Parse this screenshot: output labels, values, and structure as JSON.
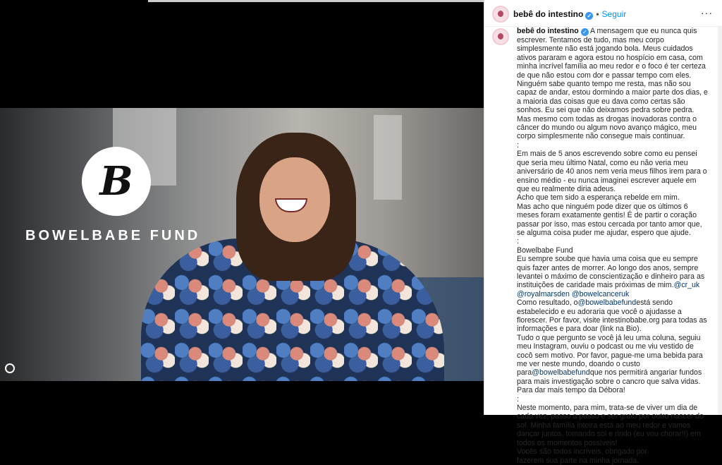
{
  "post": {
    "username": "bebê do intestino",
    "follow_label": "Seguir",
    "more_label": "···",
    "verified_mark": "✓"
  },
  "media": {
    "logo_letter": "B",
    "brand_text": "BOWELBABE FUND"
  },
  "caption": {
    "username": "bebê do intestino",
    "intro": " A mensagem que eu nunca quis escrever. Tentamos de tudo, mas meu corpo simplesmente não está jogando bola. Meus cuidados ativos pararam e agora estou no hospício em casa, com minha incrível família ao meu redor e o foco é ter certeza de que não estou com dor e passar tempo com eles. Ninguém sabe quanto tempo me resta, mas não sou capaz de andar, estou dormindo a maior parte dos dias, e a maioria das coisas que eu dava como certas são sonhos. Eu sei que não deixamos pedra sobre pedra. Mas mesmo com todas as drogas inovadoras contra o câncer do mundo ou algum novo avanço mágico, meu corpo simplesmente não consegue mais continuar.",
    "sep1": ":",
    "para2": "Em mais de 5 anos escrevendo sobre como eu pensei que seria meu último Natal, como eu não veria meu aniversário de 40 anos nem veria meus filhos irem para o ensino médio - eu nunca imaginei escrever aquele em que eu realmente diria adeus.",
    "para3": "Acho que tem sido a esperança rebelde em mim.",
    "para4": "Mas acho que ninguém pode dizer que os últimos 6 meses foram exatamente gentis! É de partir o coração passar por isso, mas estou cercada por tanto amor que, se alguma coisa puder me ajudar, espero que ajude.",
    "sep2": ":",
    "para5_title": "Bowelbabe Fund",
    "para5": "Eu sempre soube que havia uma coisa que eu sempre quis fazer antes de morrer. Ao longo dos anos, sempre levantei o máximo de conscientização e dinheiro para as instituições de caridade mais próximas de mim.",
    "mention1": "@cr_uk",
    "mention2": "@royalmarsden",
    "mention3": "@bowelcanceruk",
    "para6_a": "Como resultado, o",
    "mention4": "@bowelbabefund",
    "para6_b": "está sendo estabelecido e eu adoraria que você o ajudasse a florescer. Por favor, visite intestinobabe.org para todas as informações e para doar (link na Bio).",
    "para7_a": "Tudo o que pergunto se você já leu uma coluna, seguiu meu Instagram, ouviu o podcast ou me viu vestido de cocô sem motivo. Por favor, pague-me uma bebida para me ver neste mundo, doando o custo para",
    "mention5": "@bowelbabefund",
    "para7_b": "que nos permitirá angariar fundos para mais investigação sobre o cancro que salva vidas. Para dar mais tempo da Débora!",
    "sep3": ":",
    "para8": "Neste momento, para mim, trata-se de viver um dia de cada vez, passo a passo e ser grato por outro nascer do sol. Minha família inteira está ao meu redor e vamos dançar juntos, tomando sol e rindo (eu vou chorar!!) em todos os momentos possíveis!",
    "para9": "Vocês são todos incríveis, obrigado por",
    "para10": "fazerem sua parte na minha jornada."
  }
}
